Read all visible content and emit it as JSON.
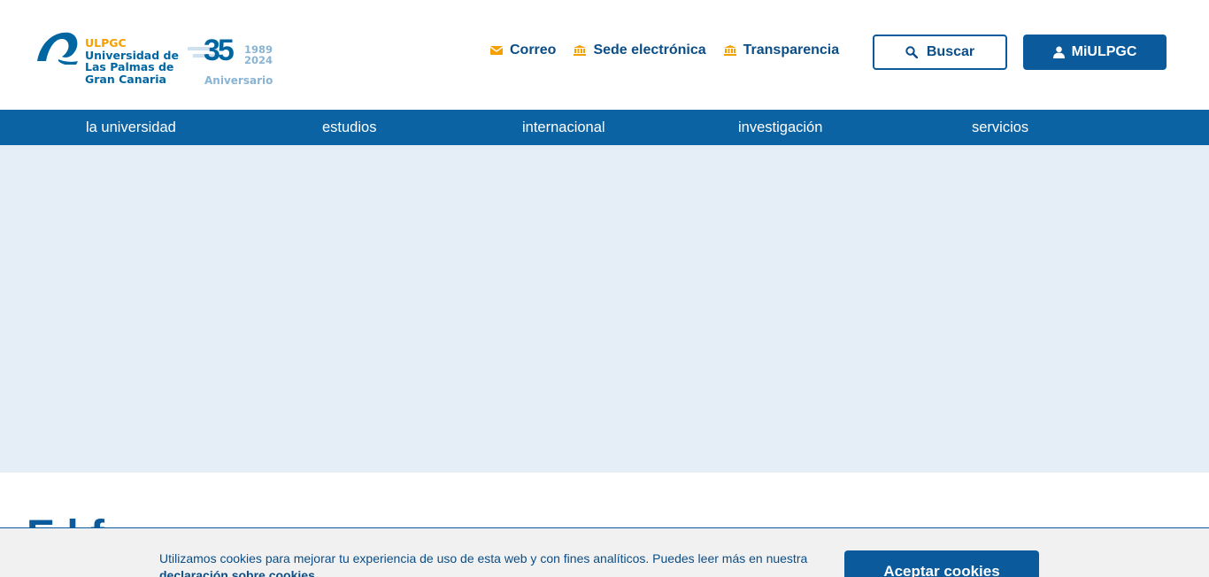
{
  "brand": {
    "line1": "ULPGC",
    "line2": "Universidad de",
    "line3": "Las Palmas de",
    "line4": "Gran Canaria",
    "anniversary_number": "35",
    "anniversary_year_start": "1989",
    "anniversary_year_end": "2024",
    "anniversary_label": "Aniversario",
    "colors": {
      "blue": "#0066a1",
      "orange": "#f5a000",
      "light_blue": "#8ab4d4"
    }
  },
  "header": {
    "links": [
      {
        "label": "Correo",
        "icon": "mail-icon"
      },
      {
        "label": "Sede electrónica",
        "icon": "institution-icon"
      },
      {
        "label": "Transparencia",
        "icon": "institution-icon"
      }
    ],
    "search_label": "Buscar",
    "account_label": "MiULPGC"
  },
  "nav": {
    "items": [
      {
        "label": "la universidad"
      },
      {
        "label": "estudios"
      },
      {
        "label": "internacional"
      },
      {
        "label": "investigación"
      },
      {
        "label": "servicios"
      }
    ]
  },
  "main": {
    "heading": "E                  l    f"
  },
  "cookie_banner": {
    "text": "Utilizamos cookies para mejorar tu experiencia de uso de esta web y con fines analíticos. Puedes leer más en nuestra",
    "link_label": "declaración sobre cookies",
    "button_label": "Aceptar cookies"
  },
  "colors": {
    "primary": "#0b5b9c",
    "nav_bg": "#0b63a3",
    "hero_bg": "#e5eef7",
    "accent": "#f5a000",
    "cookie_bg": "#f1f1f1"
  }
}
